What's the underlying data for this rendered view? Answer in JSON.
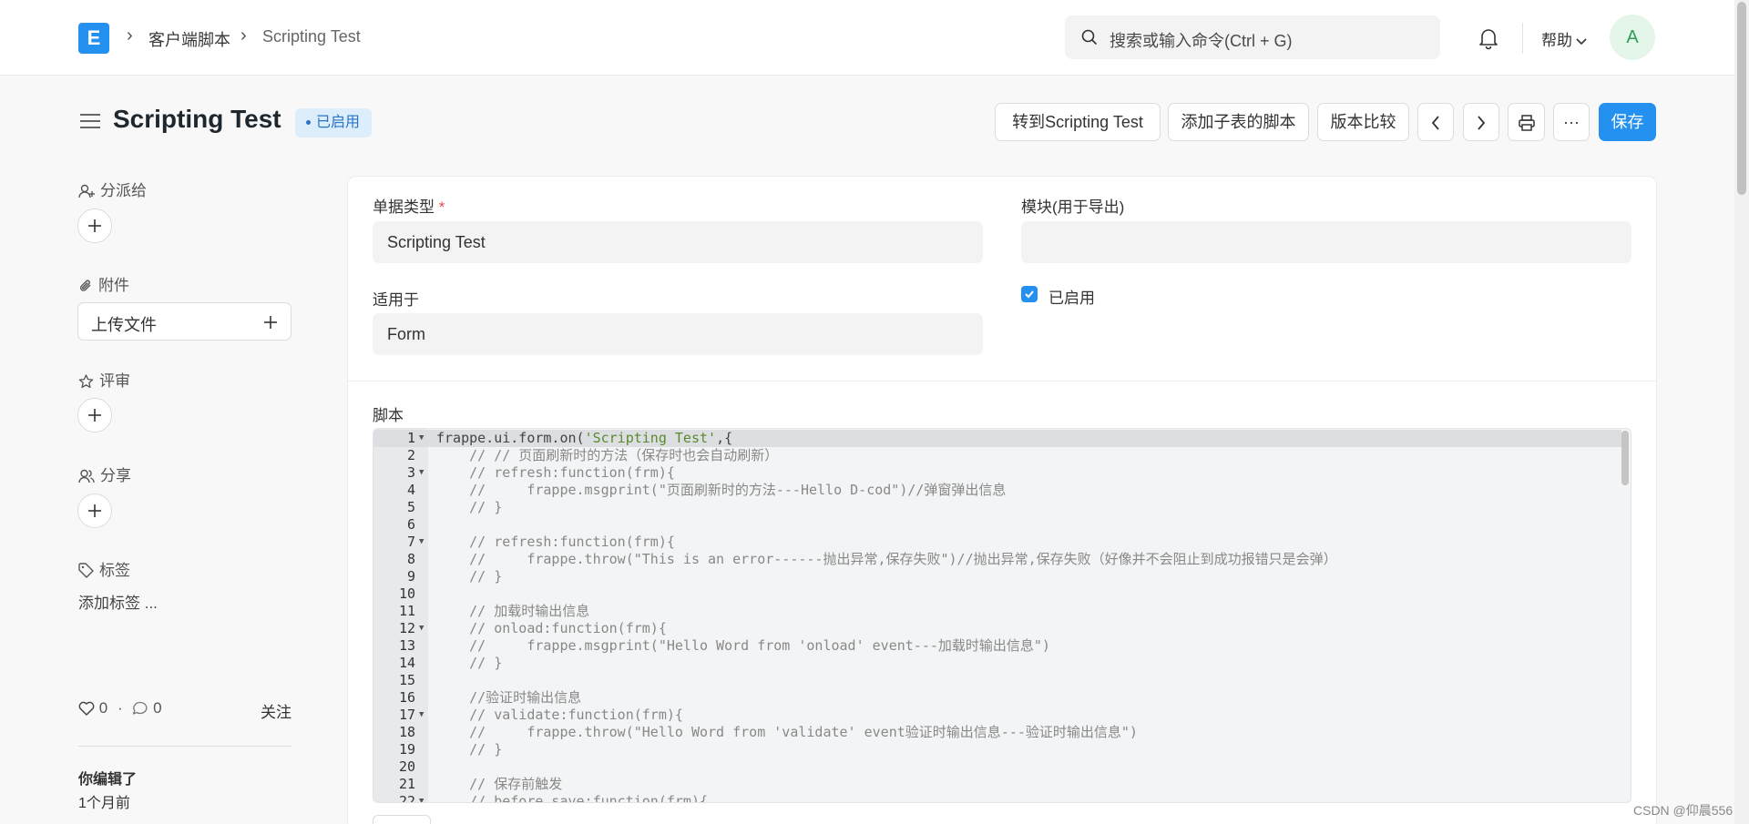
{
  "breadcrumb": {
    "logo": "E",
    "item1": "客户端脚本",
    "item2": "Scripting Test"
  },
  "navbar": {
    "search_placeholder": "搜索或输入命令(Ctrl + G)",
    "help": "帮助",
    "avatar": "A"
  },
  "page": {
    "title": "Scripting Test",
    "status": "已启用",
    "actions": {
      "goto": "转到Scripting Test",
      "add_child_script": "添加子表的脚本",
      "compare": "版本比较",
      "more": "···",
      "save": "保存"
    }
  },
  "sidebar": {
    "assign": "分派给",
    "attachments": "附件",
    "upload": "上传文件",
    "review": "评审",
    "share": "分享",
    "tags": "标签",
    "add_tag": "添加标签 ...",
    "likes": "0",
    "comments": "0",
    "follow": "关注",
    "edited_by": "你编辑了",
    "edited_when": "1个月前"
  },
  "form": {
    "doctype_label": "单据类型",
    "doctype_value": "Scripting Test",
    "module_label": "模块(用于导出)",
    "module_value": "",
    "apply_label": "适用于",
    "apply_value": "Form",
    "enabled_label": "已启用",
    "enabled": true,
    "script_label": "脚本"
  },
  "code_lines": [
    "frappe.ui.form.on('Scripting Test',{",
    "    // // 页面刷新时的方法（保存时也会自动刷新）",
    "    // refresh:function(frm){",
    "    //     frappe.msgprint(\"页面刷新时的方法---Hello D-cod\")//弹窗弹出信息",
    "    // }",
    "",
    "    // refresh:function(frm){",
    "    //     frappe.throw(\"This is an error------抛出异常,保存失败\")//抛出异常,保存失败（好像并不会阻止到成功报错只是会弹）",
    "    // }",
    "",
    "    // 加载时输出信息",
    "    // onload:function(frm){",
    "    //     frappe.msgprint(\"Hello Word from 'onload' event---加载时输出信息\")",
    "    // }",
    "",
    "    //验证时输出信息",
    "    // validate:function(frm){",
    "    //     frappe.throw(\"Hello Word from 'validate' event验证时输出信息---验证时输出信息\")",
    "    // }",
    "",
    "    // 保存前触发",
    "    // before_save:function(frm){"
  ],
  "fold_lines": [
    1,
    3,
    7,
    12,
    17,
    22
  ],
  "watermark": "CSDN @仰晨556"
}
